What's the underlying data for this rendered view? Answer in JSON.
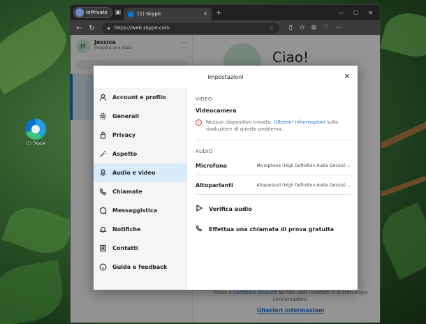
{
  "desktop": {
    "icon_label": "(1) Skype"
  },
  "browser": {
    "inprivate_label": "InPrivate",
    "tab_title": "(1) Skype",
    "url": "https://web.skype.com"
  },
  "skype": {
    "avatar_initials": "JS",
    "user_name": "Jessica",
    "status_text": "Imposta uno stato",
    "greeting": "Ciao!",
    "footer_prefix": "Prova a",
    "footer_link": "cambiare account",
    "footer_suffix": "se non vedi i contatti o la cronologia conversazioni.",
    "footer_more": "Ulteriori informazioni"
  },
  "dialog": {
    "title": "Impostazioni",
    "menu": [
      {
        "label": "Account e profilo",
        "icon": "user-icon"
      },
      {
        "label": "Generali",
        "icon": "gear-icon"
      },
      {
        "label": "Privacy",
        "icon": "lock-icon"
      },
      {
        "label": "Aspetto",
        "icon": "wand-icon"
      },
      {
        "label": "Audio e video",
        "icon": "microphone-icon"
      },
      {
        "label": "Chiamate",
        "icon": "phone-icon"
      },
      {
        "label": "Messaggistica",
        "icon": "chat-icon"
      },
      {
        "label": "Notifiche",
        "icon": "bell-icon"
      },
      {
        "label": "Contatti",
        "icon": "contacts-icon"
      },
      {
        "label": "Guida e feedback",
        "icon": "info-icon"
      }
    ],
    "active_index": 4,
    "video_section": "VIDEO",
    "camera_label": "Videocamera",
    "camera_warning": "Nessun dispositivo trovato.",
    "camera_warning_link": "Ulteriori informazioni",
    "camera_warning_suffix": "sulla risoluzione di questo problema.",
    "audio_section": "AUDIO",
    "mic_label": "Microfono",
    "mic_value": "Microphone (High Definition Audio Device)",
    "speaker_label": "Altoparlanti",
    "speaker_value": "Altoparlanti (High Definition Audio Device)",
    "verify_audio": "Verifica audio",
    "test_call": "Effettua una chiamata di prova gratuita"
  },
  "colors": {
    "accent": "#0078d4",
    "active_menu": "#d8ebfb",
    "warning": "#c43c3c"
  }
}
